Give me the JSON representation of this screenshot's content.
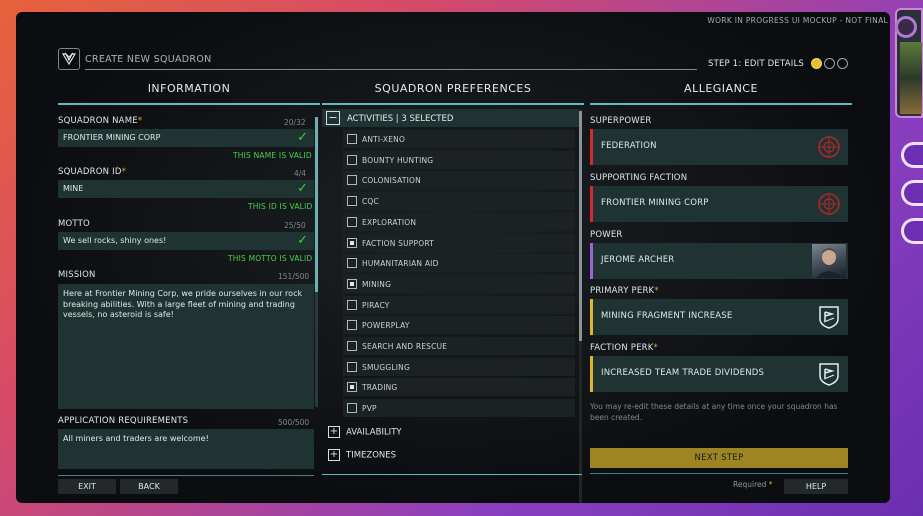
{
  "window": {
    "watermark": "WORK IN PROGRESS UI MOCKUP - NOT FINAL",
    "title": "CREATE NEW SQUADRON",
    "step_label": "STEP 1: EDIT DETAILS"
  },
  "columns": {
    "information": "INFORMATION",
    "preferences": "SQUADRON PREFERENCES",
    "allegiance": "ALLEGIANCE"
  },
  "information": {
    "name_label": "SQUADRON NAME",
    "name_count": "20/32",
    "name_value": "FRONTIER MINING CORP",
    "name_valid": "THIS NAME IS VALID",
    "id_label": "SQUADRON ID",
    "id_count": "4/4",
    "id_value": "MINE",
    "id_valid": "THIS ID IS VALID",
    "motto_label": "MOTTO",
    "motto_count": "25/50",
    "motto_value": "We sell rocks, shiny ones!",
    "motto_valid": "THIS MOTTO IS VALID",
    "mission_label": "MISSION",
    "mission_count": "151/500",
    "mission_value": "Here at Frontier Mining Corp, we pride ourselves in our rock breaking abilities. With a large fleet of mining and trading vessels, no asteroid is safe!",
    "requirements_label": "APPLICATION REQUIREMENTS",
    "requirements_count": "500/500",
    "requirements_value": "All miners and traders are welcome!",
    "required_star": "*"
  },
  "preferences": {
    "activities_title": "ACTIVITIES | 3 SELECTED",
    "activities": [
      {
        "label": "ANTI-XENO",
        "checked": false
      },
      {
        "label": "BOUNTY HUNTING",
        "checked": false
      },
      {
        "label": "COLONISATION",
        "checked": false
      },
      {
        "label": "CQC",
        "checked": false
      },
      {
        "label": "EXPLORATION",
        "checked": false
      },
      {
        "label": "FACTION SUPPORT",
        "checked": true
      },
      {
        "label": "HUMANITARIAN AID",
        "checked": false
      },
      {
        "label": "MINING",
        "checked": true
      },
      {
        "label": "PIRACY",
        "checked": false
      },
      {
        "label": "POWERPLAY",
        "checked": false
      },
      {
        "label": "SEARCH AND RESCUE",
        "checked": false
      },
      {
        "label": "SMUGGLING",
        "checked": false
      },
      {
        "label": "TRADING",
        "checked": true
      },
      {
        "label": "PVP",
        "checked": false
      }
    ],
    "availability": "AVAILABILITY",
    "timezones": "TIMEZONES"
  },
  "allegiance": {
    "superpower_label": "SUPERPOWER",
    "superpower_value": "FEDERATION",
    "faction_label": "SUPPORTING FACTION",
    "faction_value": "FRONTIER MINING CORP",
    "power_label": "POWER",
    "power_value": "JEROME ARCHER",
    "primary_perk_label": "PRIMARY PERK",
    "primary_perk_value": "MINING FRAGMENT INCREASE",
    "faction_perk_label": "FACTION PERK",
    "faction_perk_value": "INCREASED TEAM TRADE DIVIDENDS",
    "note": "You may re-edit these details at any time once your squadron has been created.",
    "next_step": "NEXT STEP"
  },
  "footer": {
    "exit": "EXIT",
    "back": "BACK",
    "required": "Required",
    "help": "HELP"
  },
  "colors": {
    "accent_teal": "#61b9c3",
    "valid_green": "#48d34a",
    "next_yellow": "#9d8621",
    "star_orange": "#e6a63a"
  }
}
